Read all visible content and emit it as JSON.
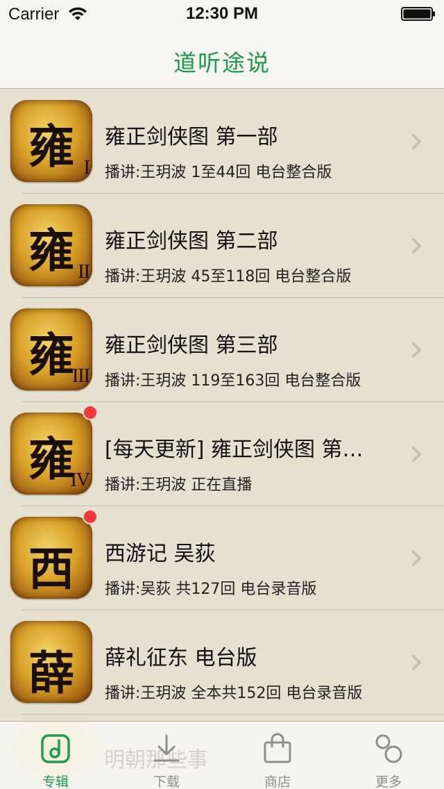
{
  "status_bar": {
    "carrier": "Carrier",
    "time": "12:30 PM"
  },
  "nav": {
    "title": "道听途说"
  },
  "colors": {
    "accent": "#1f9a4f",
    "background": "#e6e0d1",
    "badge": "#f23a3a",
    "tab_inactive": "#8e8e8e"
  },
  "albums": [
    {
      "cover_char": "雍",
      "cover_numeral": "I",
      "title": "雍正剑侠图 第一部",
      "subtitle": "播讲:王玥波 1至44回 电台整合版",
      "badge": false
    },
    {
      "cover_char": "雍",
      "cover_numeral": "II",
      "title": "雍正剑侠图 第二部",
      "subtitle": "播讲:王玥波 45至118回 电台整合版",
      "badge": false
    },
    {
      "cover_char": "雍",
      "cover_numeral": "III",
      "title": "雍正剑侠图 第三部",
      "subtitle": "播讲:王玥波 119至163回 电台整合版",
      "badge": false
    },
    {
      "cover_char": "雍",
      "cover_numeral": "IV",
      "title": "[每天更新] 雍正剑侠图 第…",
      "subtitle": "播讲:王玥波 正在直播",
      "badge": true
    },
    {
      "cover_char": "西",
      "cover_numeral": "",
      "title": "西游记 吴荻",
      "subtitle": "播讲:吴荻 共127回 电台录音版",
      "badge": true
    },
    {
      "cover_char": "薛",
      "cover_numeral": "",
      "title": "薛礼征东 电台版",
      "subtitle": "播讲:王玥波 全本共152回 电台录音版",
      "badge": false
    }
  ],
  "partial_row": {
    "title": "明朝那些事"
  },
  "tabs": [
    {
      "label": "专辑",
      "icon": "album-music-icon",
      "active": true
    },
    {
      "label": "下载",
      "icon": "download-icon",
      "active": false
    },
    {
      "label": "商店",
      "icon": "shopping-bag-icon",
      "active": false
    },
    {
      "label": "更多",
      "icon": "more-circles-icon",
      "active": false
    }
  ]
}
